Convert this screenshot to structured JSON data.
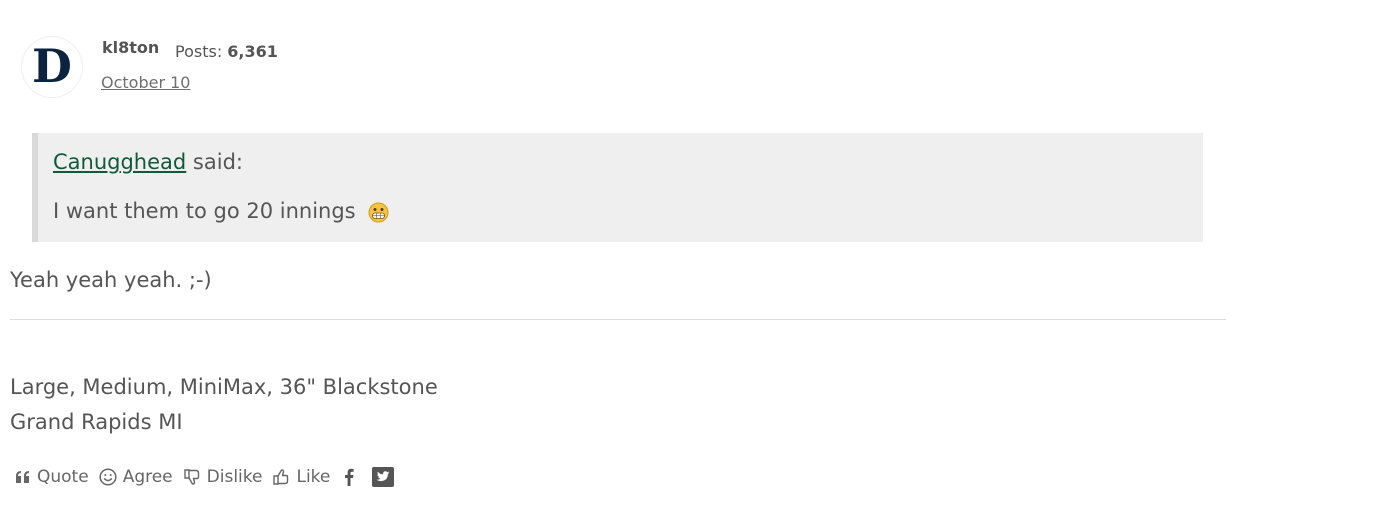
{
  "author": {
    "name": "kl8ton",
    "posts_label": "Posts:",
    "posts_count": "6,361",
    "date": "October 10",
    "avatar_letter": "D"
  },
  "quote": {
    "author": "Canugghead",
    "said": " said:",
    "text": "I want them to go 20 innings"
  },
  "body": {
    "text": "Yeah yeah yeah. ;-)"
  },
  "signature": {
    "line1": "Large, Medium, MiniMax, 36\" Blackstone",
    "line2": "Grand Rapids MI"
  },
  "actions": {
    "quote": "Quote",
    "agree": "Agree",
    "dislike": "Dislike",
    "like": "Like"
  },
  "colors": {
    "link": "#0f5a3b",
    "quote_bg": "#efefef",
    "text": "#555555"
  }
}
